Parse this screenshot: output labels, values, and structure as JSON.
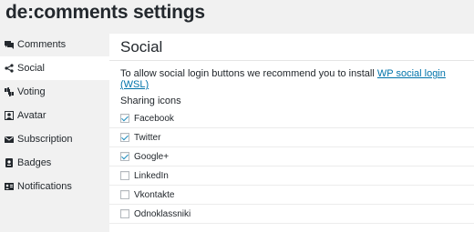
{
  "page": {
    "title": "de:comments settings"
  },
  "sidebar": {
    "items": [
      {
        "label": "Comments",
        "icon": "comments-icon",
        "active": false
      },
      {
        "label": "Social",
        "icon": "share-icon",
        "active": true
      },
      {
        "label": "Voting",
        "icon": "thumbs-icon",
        "active": false
      },
      {
        "label": "Avatar",
        "icon": "avatar-icon",
        "active": false
      },
      {
        "label": "Subscription",
        "icon": "email-icon",
        "active": false
      },
      {
        "label": "Badges",
        "icon": "badge-icon",
        "active": false
      },
      {
        "label": "Notifications",
        "icon": "notification-icon",
        "active": false
      }
    ]
  },
  "main": {
    "section_title": "Social",
    "intro_text": "To allow social login buttons we recommend you to install ",
    "intro_link": "WP social login (WSL)",
    "sharing_heading": "Sharing icons",
    "sharing_options": [
      {
        "label": "Facebook",
        "checked": true
      },
      {
        "label": "Twitter",
        "checked": true
      },
      {
        "label": "Google+",
        "checked": true
      },
      {
        "label": "LinkedIn",
        "checked": false
      },
      {
        "label": "Vkontakte",
        "checked": false
      },
      {
        "label": "Odnoklassniki",
        "checked": false
      }
    ]
  },
  "colors": {
    "link": "#0073aa",
    "check": "#1e8cbe",
    "background": "#f1f1f1"
  }
}
